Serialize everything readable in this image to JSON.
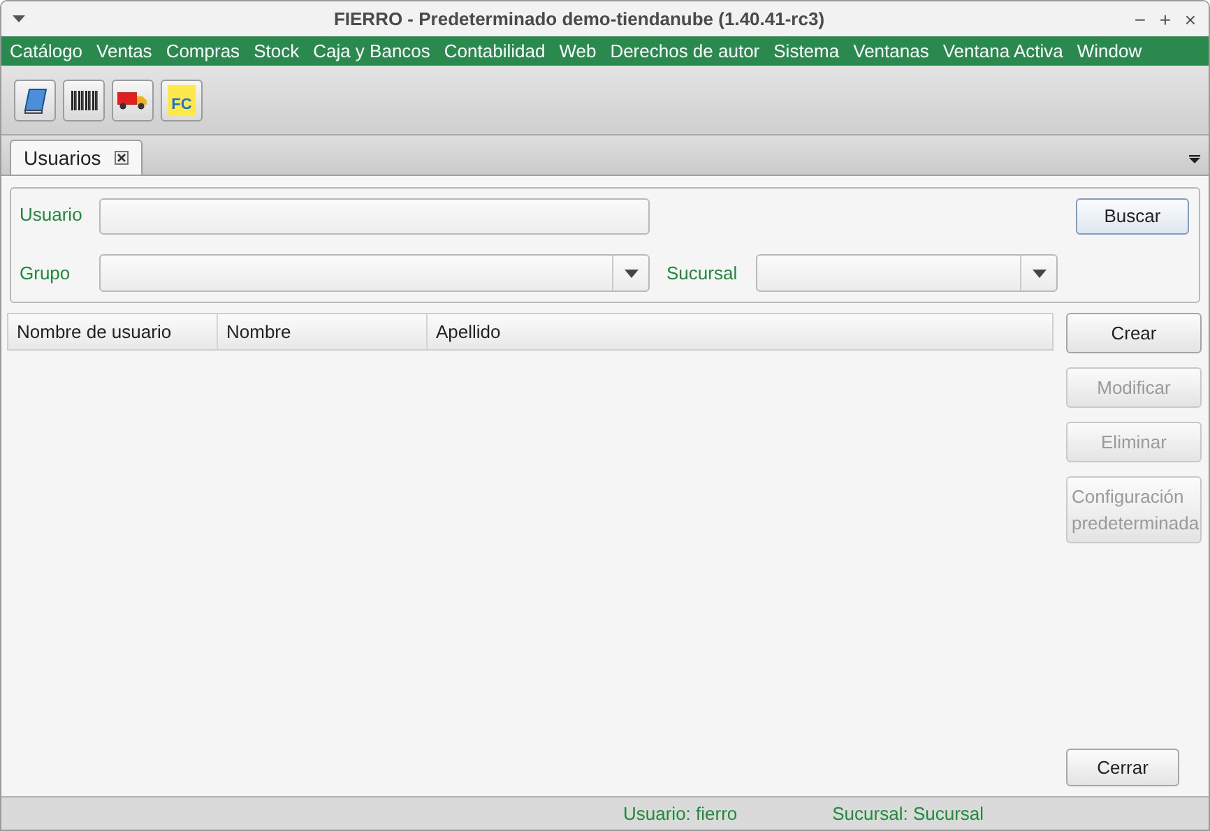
{
  "window": {
    "title": "FIERRO - Predeterminado demo-tiendanube (1.40.41-rc3)",
    "controls": [
      "−",
      "+",
      "×"
    ]
  },
  "menu": [
    "Catálogo",
    "Ventas",
    "Compras",
    "Stock",
    "Caja y Bancos",
    "Contabilidad",
    "Web",
    "Derechos de autor",
    "Sistema",
    "Ventanas",
    "Ventana Activa",
    "Window"
  ],
  "toolbar": [
    {
      "kind": "book"
    },
    {
      "kind": "barcode"
    },
    {
      "kind": "truck"
    },
    {
      "kind": "fc",
      "label": "FC"
    }
  ],
  "tabs": [
    {
      "label": "Usuarios",
      "selected": true
    }
  ],
  "search": {
    "usuario_label": "Usuario",
    "grupo_label": "Grupo",
    "sucursal_label": "Sucursal",
    "search_button": "Buscar"
  },
  "table": {
    "columns": [
      "Nombre de usuario",
      "Nombre",
      "Apellido"
    ]
  },
  "actions": [
    {
      "label": "Crear",
      "disabled": false
    },
    {
      "label": "Modificar",
      "disabled": true
    },
    {
      "label": "Eliminar",
      "disabled": true
    },
    {
      "label": "Configuración predeterminada",
      "disabled": true
    }
  ],
  "close_button": "Cerrar",
  "status_bar": [
    "Usuario: fierro",
    "Sucursal: Sucursal"
  ]
}
